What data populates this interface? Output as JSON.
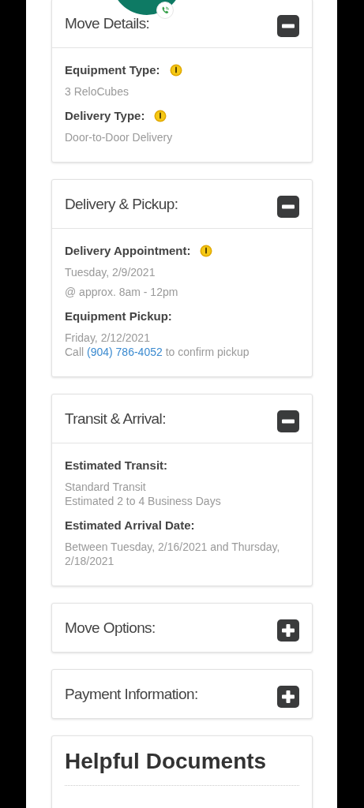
{
  "sections": [
    {
      "title": "Move Details:",
      "expanded": true,
      "fields": [
        {
          "label": "Equipment Type:",
          "info": true,
          "paragraphs": [
            [
              {
                "kind": "text",
                "text": "3 ReloCubes"
              }
            ]
          ]
        },
        {
          "label": "Delivery Type:",
          "info": true,
          "paragraphs": [
            [
              {
                "kind": "text",
                "text": "Door-to-Door Delivery"
              }
            ]
          ]
        }
      ]
    },
    {
      "title": "Delivery & Pickup:",
      "expanded": true,
      "fields": [
        {
          "label": "Delivery Appointment:",
          "info": true,
          "paragraphs": [
            [
              {
                "kind": "text",
                "text": "Tuesday, 2/9/2021"
              }
            ],
            [
              {
                "kind": "text",
                "text": "@ approx. 8am - 12pm"
              }
            ]
          ]
        },
        {
          "label": "Equipment Pickup:",
          "info": false,
          "paragraphs": [
            [
              {
                "kind": "text",
                "text": "Friday, 2/12/2021"
              },
              {
                "kind": "call",
                "prefix": "Call",
                "link": "(904) 786-4052",
                "suffix": "to confirm pickup"
              }
            ]
          ]
        }
      ]
    },
    {
      "title": "Transit & Arrival:",
      "expanded": true,
      "fields": [
        {
          "label": "Estimated Transit:",
          "info": false,
          "paragraphs": [
            [
              {
                "kind": "text",
                "text": "Standard Transit"
              },
              {
                "kind": "text",
                "text": "Estimated 2 to 4 Business Days"
              }
            ]
          ]
        },
        {
          "label": "Estimated Arrival Date:",
          "info": false,
          "paragraphs": [
            [
              {
                "kind": "text",
                "text": "Between Tuesday, 2/16/2021 and Thursday, 2/18/2021"
              }
            ]
          ]
        }
      ]
    },
    {
      "title": "Move Options:",
      "expanded": false
    },
    {
      "title": "Payment Information:",
      "expanded": false
    }
  ],
  "documents": {
    "title": "Helpful Documents"
  }
}
